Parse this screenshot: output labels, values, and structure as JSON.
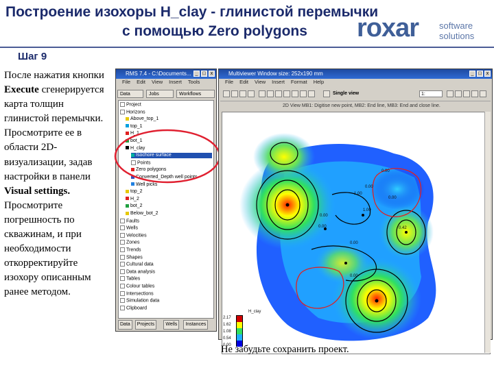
{
  "slide": {
    "title_line1": "Построение изохоры H_clay - глинистой перемычки",
    "title_line2": "с помощью Zero polygons",
    "step": "Шаг 9",
    "logo": {
      "word": "roxar",
      "sub1": "software",
      "sub2": "solutions"
    },
    "body": {
      "p1": "После нажатия кнопки ",
      "execute": "Execute",
      "p2": " сгенерируется карта толщин глинистой перемычки. Просмотрите ее в области 2D-визуализации, задав настройки в панели ",
      "visual": "Visual settings.",
      "p3": " Просмотрите погрешность по скважинам, и при необходимости откорректируйте изохору описанным ранее методом."
    },
    "note": "Не забудьте сохранить проект."
  },
  "rms_window": {
    "title": "RMS 7.4 - C:\\Documents...",
    "menu": [
      "File",
      "Edit",
      "View",
      "Insert",
      "Tools"
    ],
    "tabs": [
      "Data",
      "Jobs",
      "Workflows"
    ],
    "tree": [
      {
        "label": "Project",
        "indent": 0,
        "color": ""
      },
      {
        "label": "Horizons",
        "indent": 0,
        "color": ""
      },
      {
        "label": "Above_top_1",
        "indent": 1,
        "color": "#e6c800"
      },
      {
        "label": "top_1",
        "indent": 1,
        "color": "#00a0e0"
      },
      {
        "label": "H_1",
        "indent": 1,
        "color": "#e02020"
      },
      {
        "label": "bot_1",
        "indent": 1,
        "color": "#20a040"
      },
      {
        "label": "H_clay",
        "indent": 1,
        "color": "#000000"
      },
      {
        "label": "Isochore surface",
        "indent": 2,
        "color": "#00b0a0"
      },
      {
        "label": "Points",
        "indent": 2,
        "color": ""
      },
      {
        "label": "Zero polygons",
        "indent": 2,
        "color": "#e02020"
      },
      {
        "label": "Converted_Depth well points",
        "indent": 2,
        "color": "#3050c0"
      },
      {
        "label": "Well picks",
        "indent": 2,
        "color": "#2080e0"
      },
      {
        "label": "top_2",
        "indent": 1,
        "color": "#e6c800"
      },
      {
        "label": "H_2",
        "indent": 1,
        "color": "#e02020"
      },
      {
        "label": "bot_2",
        "indent": 1,
        "color": "#20a040"
      },
      {
        "label": "Below_bot_2",
        "indent": 1,
        "color": "#e6c800"
      },
      {
        "label": "Faults",
        "indent": 0,
        "color": ""
      },
      {
        "label": "Wells",
        "indent": 0,
        "color": ""
      },
      {
        "label": "Velocities",
        "indent": 0,
        "color": ""
      },
      {
        "label": "Zones",
        "indent": 0,
        "color": ""
      },
      {
        "label": "Trends",
        "indent": 0,
        "color": ""
      },
      {
        "label": "Shapes",
        "indent": 0,
        "color": ""
      },
      {
        "label": "Cultural data",
        "indent": 0,
        "color": ""
      },
      {
        "label": "Data analysis",
        "indent": 0,
        "color": ""
      },
      {
        "label": "Tables",
        "indent": 0,
        "color": ""
      },
      {
        "label": "Colour tables",
        "indent": 0,
        "color": ""
      },
      {
        "label": "Intersections",
        "indent": 0,
        "color": ""
      },
      {
        "label": "Simulation data",
        "indent": 0,
        "color": ""
      },
      {
        "label": "Clipboard",
        "indent": 0,
        "color": ""
      }
    ],
    "bottom_tabs": [
      "Data",
      "Projects",
      "Wells",
      "Instances"
    ]
  },
  "multiviewer": {
    "title": "Multiviewer   Window size: 252x190 mm",
    "menu": [
      "File",
      "Edit",
      "View",
      "Insert",
      "Format",
      "Help"
    ],
    "single_view": "Single view",
    "zoom": "1:",
    "status": "2D View   MB1: Digitise new point, MB2: End line, MB3: End and close line.",
    "legend": {
      "title": "H_clay",
      "values": [
        "2.17",
        "1.62",
        "1.08",
        "0.54",
        "0.00"
      ],
      "colors": [
        "#d00000",
        "#ffff00",
        "#30e060",
        "#20b0ff",
        "#0000e0"
      ]
    },
    "contour_labels": [
      "0.00",
      "0.00",
      "0.00",
      "1.00",
      "1.00",
      "0.00",
      "0.00",
      "0.00",
      "0.00",
      "0.42"
    ]
  }
}
